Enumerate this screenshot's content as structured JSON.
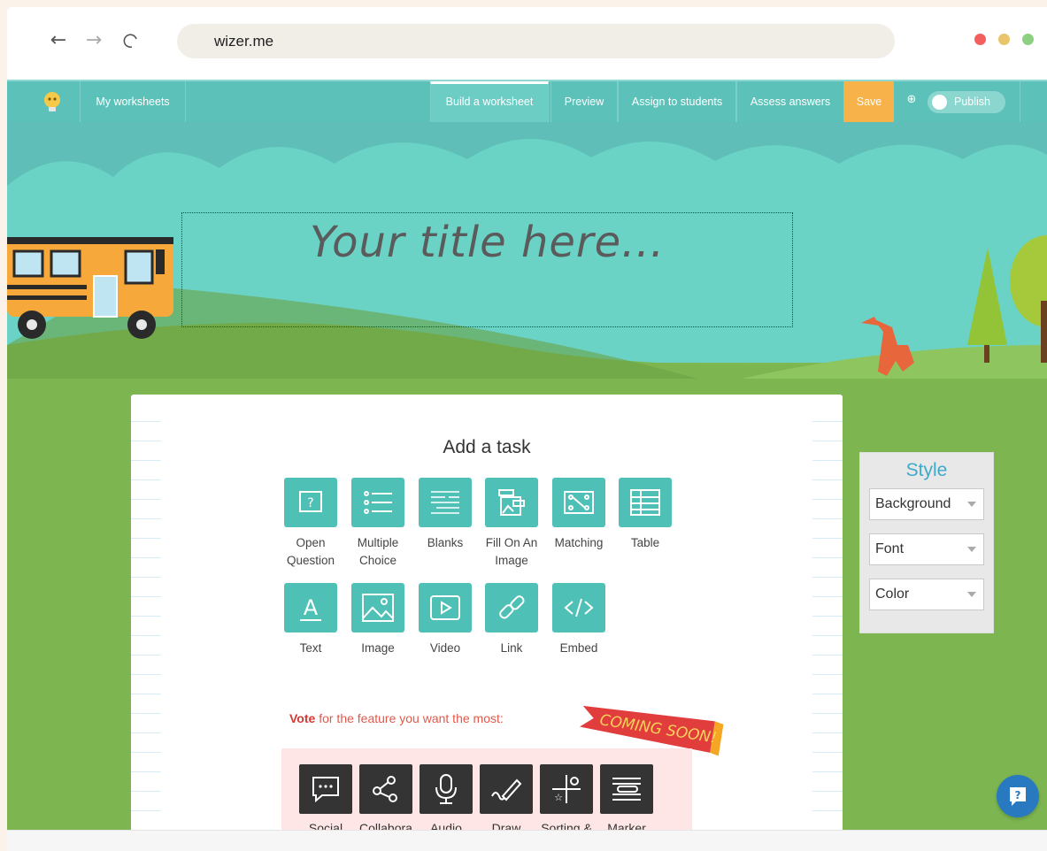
{
  "browser": {
    "url": "wizer.me",
    "window_dot_colors": [
      "#f25f5c",
      "#e9c46a",
      "#8ed081"
    ]
  },
  "appbar": {
    "my_worksheets": "My worksheets",
    "build": "Build a worksheet",
    "preview": "Preview",
    "assign": "Assign to students",
    "assess": "Assess answers",
    "save": "Save",
    "publish": "Publish",
    "publish_enabled": false
  },
  "header": {
    "title_placeholder": "Your title here..."
  },
  "worksheet": {
    "add_task_heading": "Add a task",
    "tasks": [
      {
        "label": "Open Question",
        "icon": "open-question-icon"
      },
      {
        "label": "Multiple Choice",
        "icon": "multiple-choice-icon"
      },
      {
        "label": "Blanks",
        "icon": "blanks-icon"
      },
      {
        "label": "Fill On An Image",
        "icon": "fill-on-image-icon"
      },
      {
        "label": "Matching",
        "icon": "matching-icon"
      },
      {
        "label": "Table",
        "icon": "table-icon"
      },
      {
        "label": "Text",
        "icon": "text-icon"
      },
      {
        "label": "Image",
        "icon": "image-icon"
      },
      {
        "label": "Video",
        "icon": "video-icon"
      },
      {
        "label": "Link",
        "icon": "link-icon"
      },
      {
        "label": "Embed",
        "icon": "embed-icon"
      }
    ],
    "vote_strong": "Vote",
    "vote_rest": " for the feature you want the most:",
    "coming_soon": "COMING SOON!",
    "vote_features": [
      {
        "label": "Social",
        "icon": "social-icon"
      },
      {
        "label": "Collabora",
        "icon": "collaborate-icon"
      },
      {
        "label": "Audio",
        "icon": "microphone-icon"
      },
      {
        "label": "Draw",
        "icon": "draw-icon"
      },
      {
        "label": "Sorting &",
        "icon": "sorting-icon"
      },
      {
        "label": "Marker",
        "icon": "marker-icon"
      }
    ]
  },
  "style_panel": {
    "title": "Style",
    "background": "Background",
    "font": "Font",
    "color": "Color"
  },
  "colors": {
    "teal": "#5cc1b8",
    "save_orange": "#f7b24a",
    "task_tile": "#4ec0b6",
    "vote_red": "#d23a33"
  }
}
